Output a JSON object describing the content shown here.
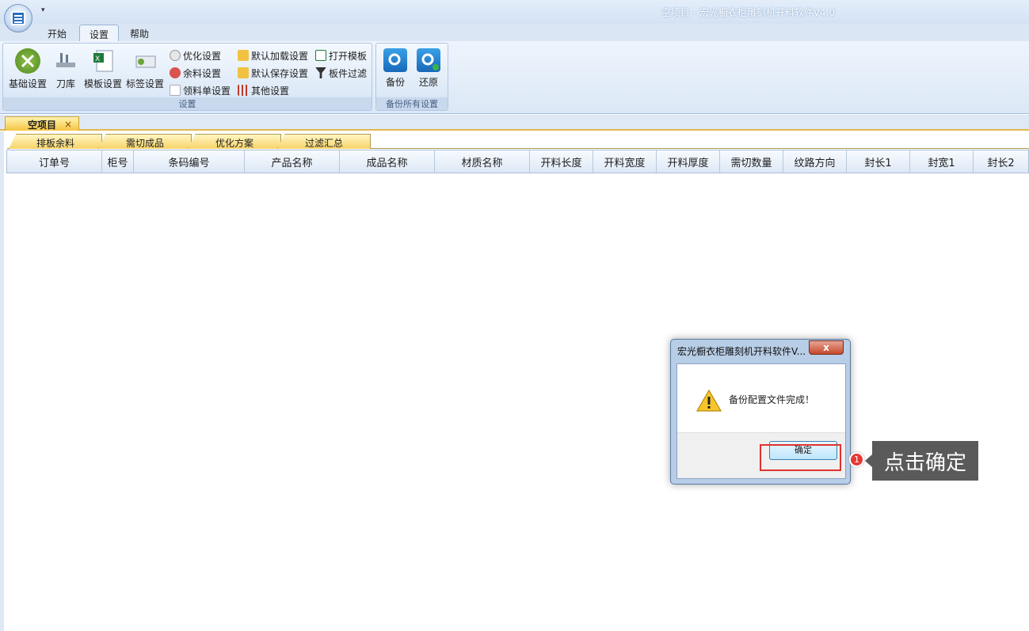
{
  "window": {
    "title": "空项目 - 宏光橱衣柜雕刻机开料软件V4.0"
  },
  "ribbon_tabs": [
    {
      "label": "开始",
      "active": false
    },
    {
      "label": "设置",
      "active": true
    },
    {
      "label": "帮助",
      "active": false
    }
  ],
  "ribbon": {
    "settings_group": {
      "label": "设置",
      "big_buttons": [
        {
          "label": "基础设置",
          "icon": "wrench-icon"
        },
        {
          "label": "刀库",
          "icon": "tool-rack-icon"
        },
        {
          "label": "模板设置",
          "icon": "excel-template-icon"
        },
        {
          "label": "标签设置",
          "icon": "label-icon"
        }
      ],
      "small_buttons": [
        {
          "label": "优化设置",
          "icon": "clock-icon"
        },
        {
          "label": "余料设置",
          "icon": "leftover-icon"
        },
        {
          "label": "领料单设置",
          "icon": "document-icon"
        },
        {
          "label": "默认加载设置",
          "icon": "folder-load-icon"
        },
        {
          "label": "默认保存设置",
          "icon": "folder-save-icon"
        },
        {
          "label": "其他设置",
          "icon": "sliders-icon"
        },
        {
          "label": "打开模板",
          "icon": "open-template-icon"
        },
        {
          "label": "板件过滤",
          "icon": "filter-icon"
        }
      ]
    },
    "backup_group": {
      "label": "备份所有设置",
      "buttons": [
        {
          "label": "备份",
          "icon": "gear-save-icon"
        },
        {
          "label": "还原",
          "icon": "gear-restore-icon"
        }
      ]
    }
  },
  "document_tab": {
    "label": "空项目",
    "close": "×"
  },
  "sub_tabs": [
    "排板余料",
    "需切成品",
    "优化方案",
    "过滤汇总"
  ],
  "grid_columns": [
    "订单号",
    "柜号",
    "条码编号",
    "产品名称",
    "成品名称",
    "材质名称",
    "开料长度",
    "开料宽度",
    "开料厚度",
    "需切数量",
    "纹路方向",
    "封长1",
    "封宽1",
    "封长2"
  ],
  "dialog": {
    "title": "宏光橱衣柜雕刻机开料软件V...",
    "close": "x",
    "message": "备份配置文件完成！",
    "ok_label": "确定"
  },
  "annotation": {
    "step": "1",
    "text": "点击确定"
  },
  "colors": {
    "accent_red": "#e0322f",
    "callout_bg": "#5a5a5a",
    "tab_gold": "#f5c542"
  }
}
